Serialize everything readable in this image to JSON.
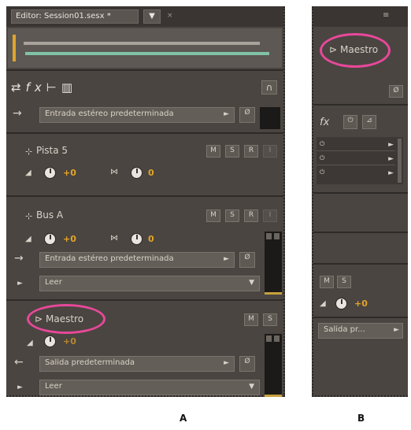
{
  "panel_a": {
    "editor_tab": "Editor: Session01.sesx *",
    "tab_menu": "▼",
    "toolbar_icons": [
      "input-output-icon",
      "fx-icon",
      "sends-icon",
      "eq-icon",
      "headphones-icon"
    ],
    "track_input": "Entrada estéreo predeterminada",
    "pista5": {
      "name": "Pista 5",
      "volume": "+0",
      "pan": "0",
      "buttons": [
        "M",
        "S",
        "R",
        "I"
      ]
    },
    "bus_a": {
      "name": "Bus A",
      "volume": "+0",
      "pan": "0",
      "buttons": [
        "M",
        "S",
        "R",
        "I"
      ],
      "input": "Entrada estéreo predeterminada",
      "automation": "Leer"
    },
    "maestro": {
      "name": "Maestro",
      "volume": "+0",
      "buttons": [
        "M",
        "S"
      ],
      "output": "Salida predeterminada",
      "automation": "Leer"
    },
    "caption": "A"
  },
  "panel_b": {
    "name": "Maestro",
    "buttons": [
      "M",
      "S"
    ],
    "volume": "+0",
    "output": "Salida pr...",
    "fx_label": "fx",
    "caption": "B"
  },
  "colors": {
    "highlight": "#e8489a",
    "value": "#e3a529",
    "panel": "#4a4541"
  }
}
